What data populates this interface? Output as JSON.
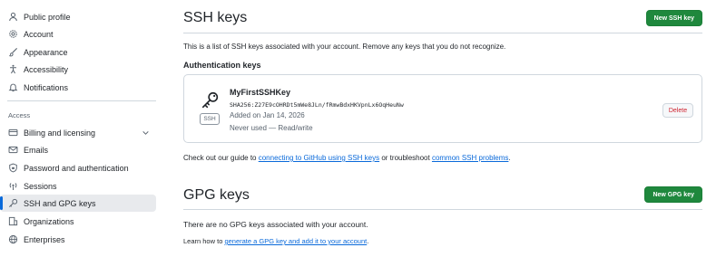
{
  "sidebar": {
    "items": [
      {
        "label": "Public profile",
        "icon": "person-icon"
      },
      {
        "label": "Account",
        "icon": "gear-icon"
      },
      {
        "label": "Appearance",
        "icon": "paintbrush-icon"
      },
      {
        "label": "Accessibility",
        "icon": "accessibility-icon"
      },
      {
        "label": "Notifications",
        "icon": "bell-icon"
      }
    ],
    "access_heading": "Access",
    "access_items": [
      {
        "label": "Billing and licensing",
        "icon": "credit-card-icon"
      },
      {
        "label": "Emails",
        "icon": "mail-icon"
      },
      {
        "label": "Password and authentication",
        "icon": "shield-lock-icon"
      },
      {
        "label": "Sessions",
        "icon": "broadcast-icon"
      },
      {
        "label": "SSH and GPG keys",
        "icon": "key-icon"
      },
      {
        "label": "Organizations",
        "icon": "organization-icon"
      },
      {
        "label": "Enterprises",
        "icon": "globe-icon"
      }
    ]
  },
  "ssh": {
    "title": "SSH keys",
    "new_button": "New SSH key",
    "description": "This is a list of SSH keys associated with your account. Remove any keys that you do not recognize.",
    "auth_heading": "Authentication keys",
    "key": {
      "name": "MyFirstSSHKey",
      "fingerprint": "SHA256:Z27E9cOHRDt5mWe8JLn/fRmwBdxHKVpnLx6OqHeuNw",
      "added": "Added on Jan 14, 2026",
      "used": "Never used — Read/write",
      "badge": "SSH",
      "delete_label": "Delete"
    },
    "guide_prefix": "Check out our guide to ",
    "guide_link1": "connecting to GitHub using SSH keys",
    "guide_middle": " or troubleshoot ",
    "guide_link2": "common SSH problems",
    "guide_suffix": "."
  },
  "gpg": {
    "title": "GPG keys",
    "new_button": "New GPG key",
    "empty_text": "There are no GPG keys associated with your account.",
    "learn_prefix": "Learn how to ",
    "learn_link": "generate a GPG key and add it to your account",
    "learn_suffix": "."
  },
  "colors": {
    "accent": "#0969da",
    "primary_button": "#1f883d",
    "danger": "#cf222e",
    "border": "#d0d7de"
  }
}
